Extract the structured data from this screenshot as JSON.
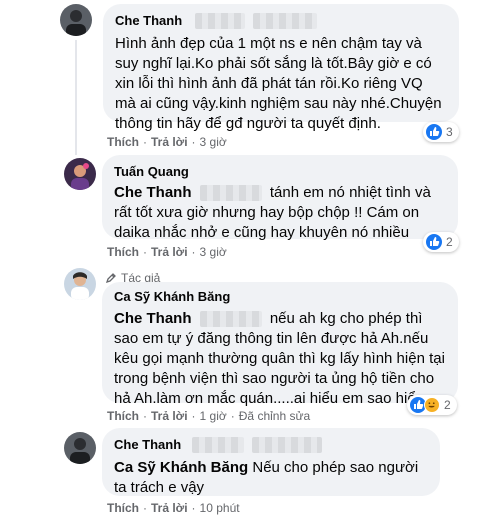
{
  "comments": [
    {
      "author": "Che Thanh",
      "text": "Hình ảnh đẹp của 1 một ns e nên chậm tay và suy nghĩ lại.Ko phải sốt sắng là tốt.Bây giờ e có xin lỗi thì hình ảnh đã phát tán rồi.Ko riêng VQ mà ai cũng vậy.kinh nghiệm sau này nhé.Chuyện thông tin hãy để gđ người ta quyết định.",
      "like_label": "Thích",
      "reply_label": "Trả lời",
      "time": "3 giờ",
      "reaction_count": "3"
    },
    {
      "author": "Tuấn Quang",
      "mention": "Che Thanh",
      "text": "tánh em nó nhiệt tình và rất tốt xưa giờ nhưng hay bộp chộp !! Cám on daika nhắc nhở e cũng hay khuyên nó nhiều",
      "like_label": "Thích",
      "reply_label": "Trả lời",
      "time": "3 giờ",
      "reaction_count": "2"
    },
    {
      "badge": "Tác giả",
      "author": "Ca Sỹ Khánh Băng",
      "mention": "Che Thanh",
      "text": "nếu ah kg cho phép thì sao em tự ý đăng thông tin lên được hả Ah.nếu kêu gọi mạnh thường quân thì kg lấy hình hiện tại trong bệnh viện thì sao người ta ủng hộ tiền cho hả Ah.làm ơn mắc quán.....ai hiểu em sao hiểu.",
      "like_label": "Thích",
      "reply_label": "Trả lời",
      "time": "1 giờ",
      "edited": "Đã chỉnh sửa",
      "reaction_count": "2"
    },
    {
      "author": "Che Thanh",
      "mention": "Ca Sỹ Khánh Băng",
      "text": "Nếu cho phép sao người ta trách e vậy",
      "like_label": "Thích",
      "reply_label": "Trả lời",
      "time": "10 phút"
    }
  ],
  "colors": {
    "like": "#1877f2",
    "haha": "#f7b125",
    "bubble": "#f0f2f5",
    "meta": "#65676b"
  },
  "icons": [
    "like-icon",
    "haha-icon",
    "author-badge-icon"
  ]
}
